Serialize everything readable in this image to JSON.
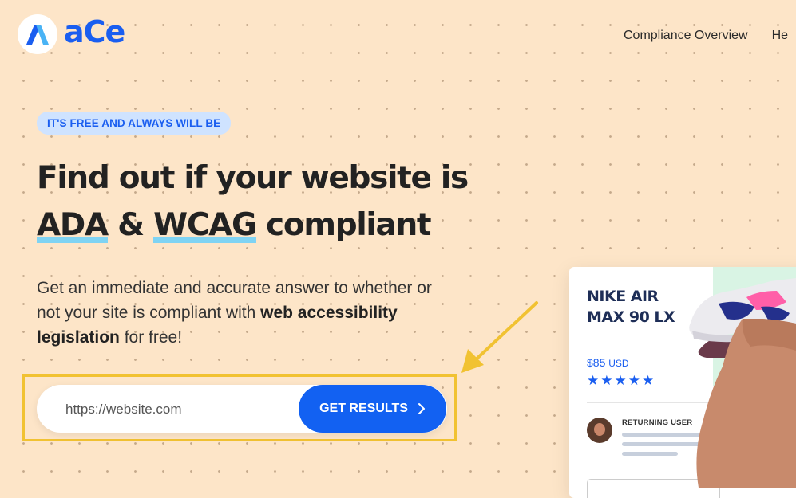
{
  "header": {
    "logo_text": "aCe",
    "nav": [
      "Compliance Overview",
      "He"
    ]
  },
  "hero": {
    "badge": "IT'S FREE AND ALWAYS WILL BE",
    "headline_line1": "Find out if your website is",
    "headline_ada": "ADA",
    "headline_amp": "&",
    "headline_wcag": "WCAG",
    "headline_tail": "compliant",
    "sub_text1": "Get an immediate and accurate answer to whether or not your site is compliant with ",
    "sub_bold": "web accessibility legislation",
    "sub_text2": " for free!"
  },
  "form": {
    "placeholder": "https://website.com",
    "button_label": "GET RESULTS",
    "button_icon": "chevron-right-icon"
  },
  "product_card": {
    "title_line1": "NIKE AIR",
    "title_line2": "MAX 90 LX",
    "price": "$85",
    "currency": "USD",
    "stars": "★★★★★",
    "user_label": "RETURNING USER"
  },
  "colors": {
    "background": "#fde5c8",
    "brand_blue": "#1261f2",
    "badge_bg": "#cfe3ff",
    "underline": "#7fd3f3",
    "highlight": "#f1c232"
  }
}
